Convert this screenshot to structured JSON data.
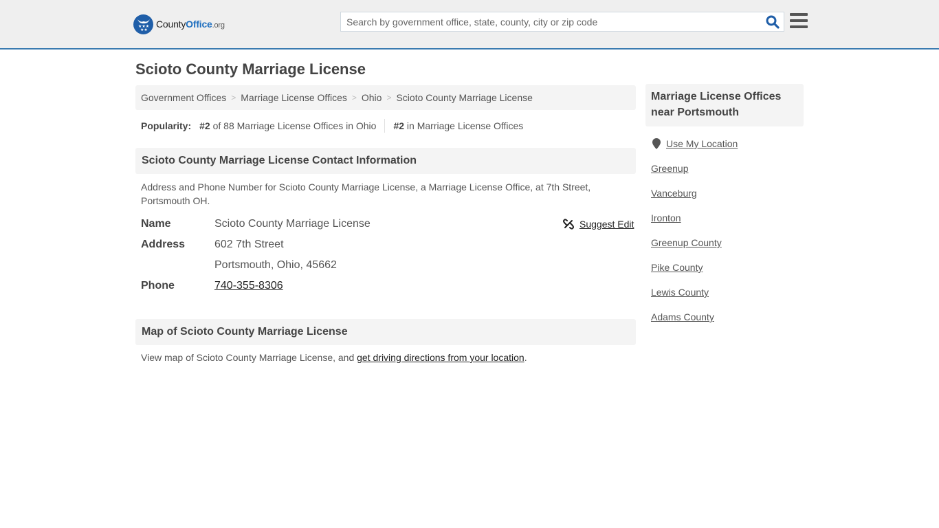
{
  "header": {
    "logo": {
      "county": "County",
      "office": "Office",
      "org": ".org"
    },
    "search": {
      "placeholder": "Search by government office, state, county, city or zip code",
      "value": ""
    },
    "colors": {
      "brand_blue": "#1f5ea8",
      "header_bg": "#efefef",
      "header_border": "#3a7bb0"
    }
  },
  "page": {
    "title": "Scioto County Marriage License"
  },
  "breadcrumb": {
    "items": [
      "Government Offices",
      "Marriage License Offices",
      "Ohio",
      "Scioto County Marriage License"
    ],
    "separator": ">"
  },
  "popularity": {
    "label": "Popularity:",
    "rank1": "#2",
    "rank1_text": " of 88 Marriage License Offices in Ohio",
    "rank2": "#2",
    "rank2_text": " in Marriage License Offices"
  },
  "contact": {
    "heading": "Scioto County Marriage License Contact Information",
    "description": "Address and Phone Number for Scioto County Marriage License, a Marriage License Office, at 7th Street, Portsmouth OH.",
    "suggest_edit": "Suggest Edit",
    "fields": {
      "name_label": "Name",
      "name_value": "Scioto County Marriage License",
      "address_label": "Address",
      "address_line1": "602 7th Street",
      "address_line2": "Portsmouth, Ohio, 45662",
      "phone_label": "Phone",
      "phone_value": "740-355-8306"
    }
  },
  "map": {
    "heading": "Map of Scioto County Marriage License",
    "text_prefix": "View map of Scioto County Marriage License, and ",
    "link_text": "get driving directions from your location",
    "text_suffix": "."
  },
  "sidebar": {
    "heading": "Marriage License Offices near Portsmouth",
    "use_location": "Use My Location",
    "links": [
      "Greenup",
      "Vanceburg",
      "Ironton",
      "Greenup County",
      "Pike County",
      "Lewis County",
      "Adams County"
    ]
  }
}
